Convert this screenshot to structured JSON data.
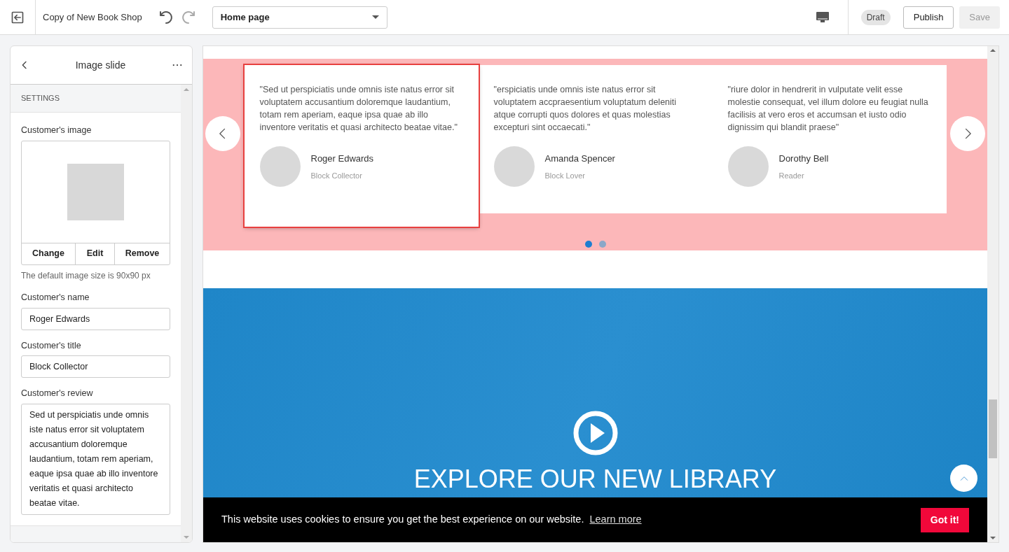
{
  "topbar": {
    "site_title": "Copy of New Book Shop",
    "page_select": "Home page",
    "status_badge": "Draft",
    "buttons": [
      {
        "label": "Publish",
        "disabled": false
      },
      {
        "label": "Save",
        "disabled": true
      }
    ]
  },
  "sidebar": {
    "title": "Image slide",
    "section": "SETTINGS",
    "image_field": {
      "label": "Customer's image",
      "actions": [
        "Change",
        "Edit",
        "Remove"
      ],
      "help": "The default image size is 90x90 px"
    },
    "fields": [
      {
        "kind": "input",
        "label": "Customer's name",
        "value": "Roger Edwards"
      },
      {
        "kind": "input",
        "label": "Customer's title",
        "value": "Block Collector"
      },
      {
        "kind": "textarea",
        "label": "Customer's review",
        "value": "Sed ut perspiciatis unde omnis iste natus error sit voluptatem accusantium doloremque laudantium, totam rem aperiam, eaque ipsa quae ab illo inventore veritatis et quasi architecto beatae vitae."
      }
    ]
  },
  "preview": {
    "testimonials": [
      {
        "quote": "\"Sed ut perspiciatis unde omnis iste natus error sit voluptatem accusantium doloremque laudantium, totam rem aperiam, eaque ipsa quae ab illo inventore veritatis et quasi architecto beatae vitae.\"",
        "name": "Roger Edwards",
        "title": "Block Collector",
        "selected": true
      },
      {
        "quote": "\"erspiciatis unde omnis iste natus error sit voluptatem accpraesentium voluptatum deleniti atque corrupti quos dolores et quas molestias excepturi sint occaecati.\"",
        "name": "Amanda Spencer",
        "title": "Block Lover",
        "selected": false
      },
      {
        "quote": "\"riure dolor in hendrerit in vulputate velit esse molestie consequat, vel illum dolore eu feugiat nulla facilisis at vero eros et accumsan et iusto odio dignissim qui blandit praese\"",
        "name": "Dorothy Bell",
        "title": "Reader",
        "selected": false
      }
    ],
    "dots": [
      {
        "selected": true
      },
      {
        "selected": false
      }
    ],
    "banner": {
      "heading": "EXPLORE OUR NEW LIBRARY"
    },
    "cookie_bar": {
      "message": "This website uses cookies to ensure you get the best experience on our website.",
      "link": "Learn more",
      "button": "Got it!"
    }
  }
}
